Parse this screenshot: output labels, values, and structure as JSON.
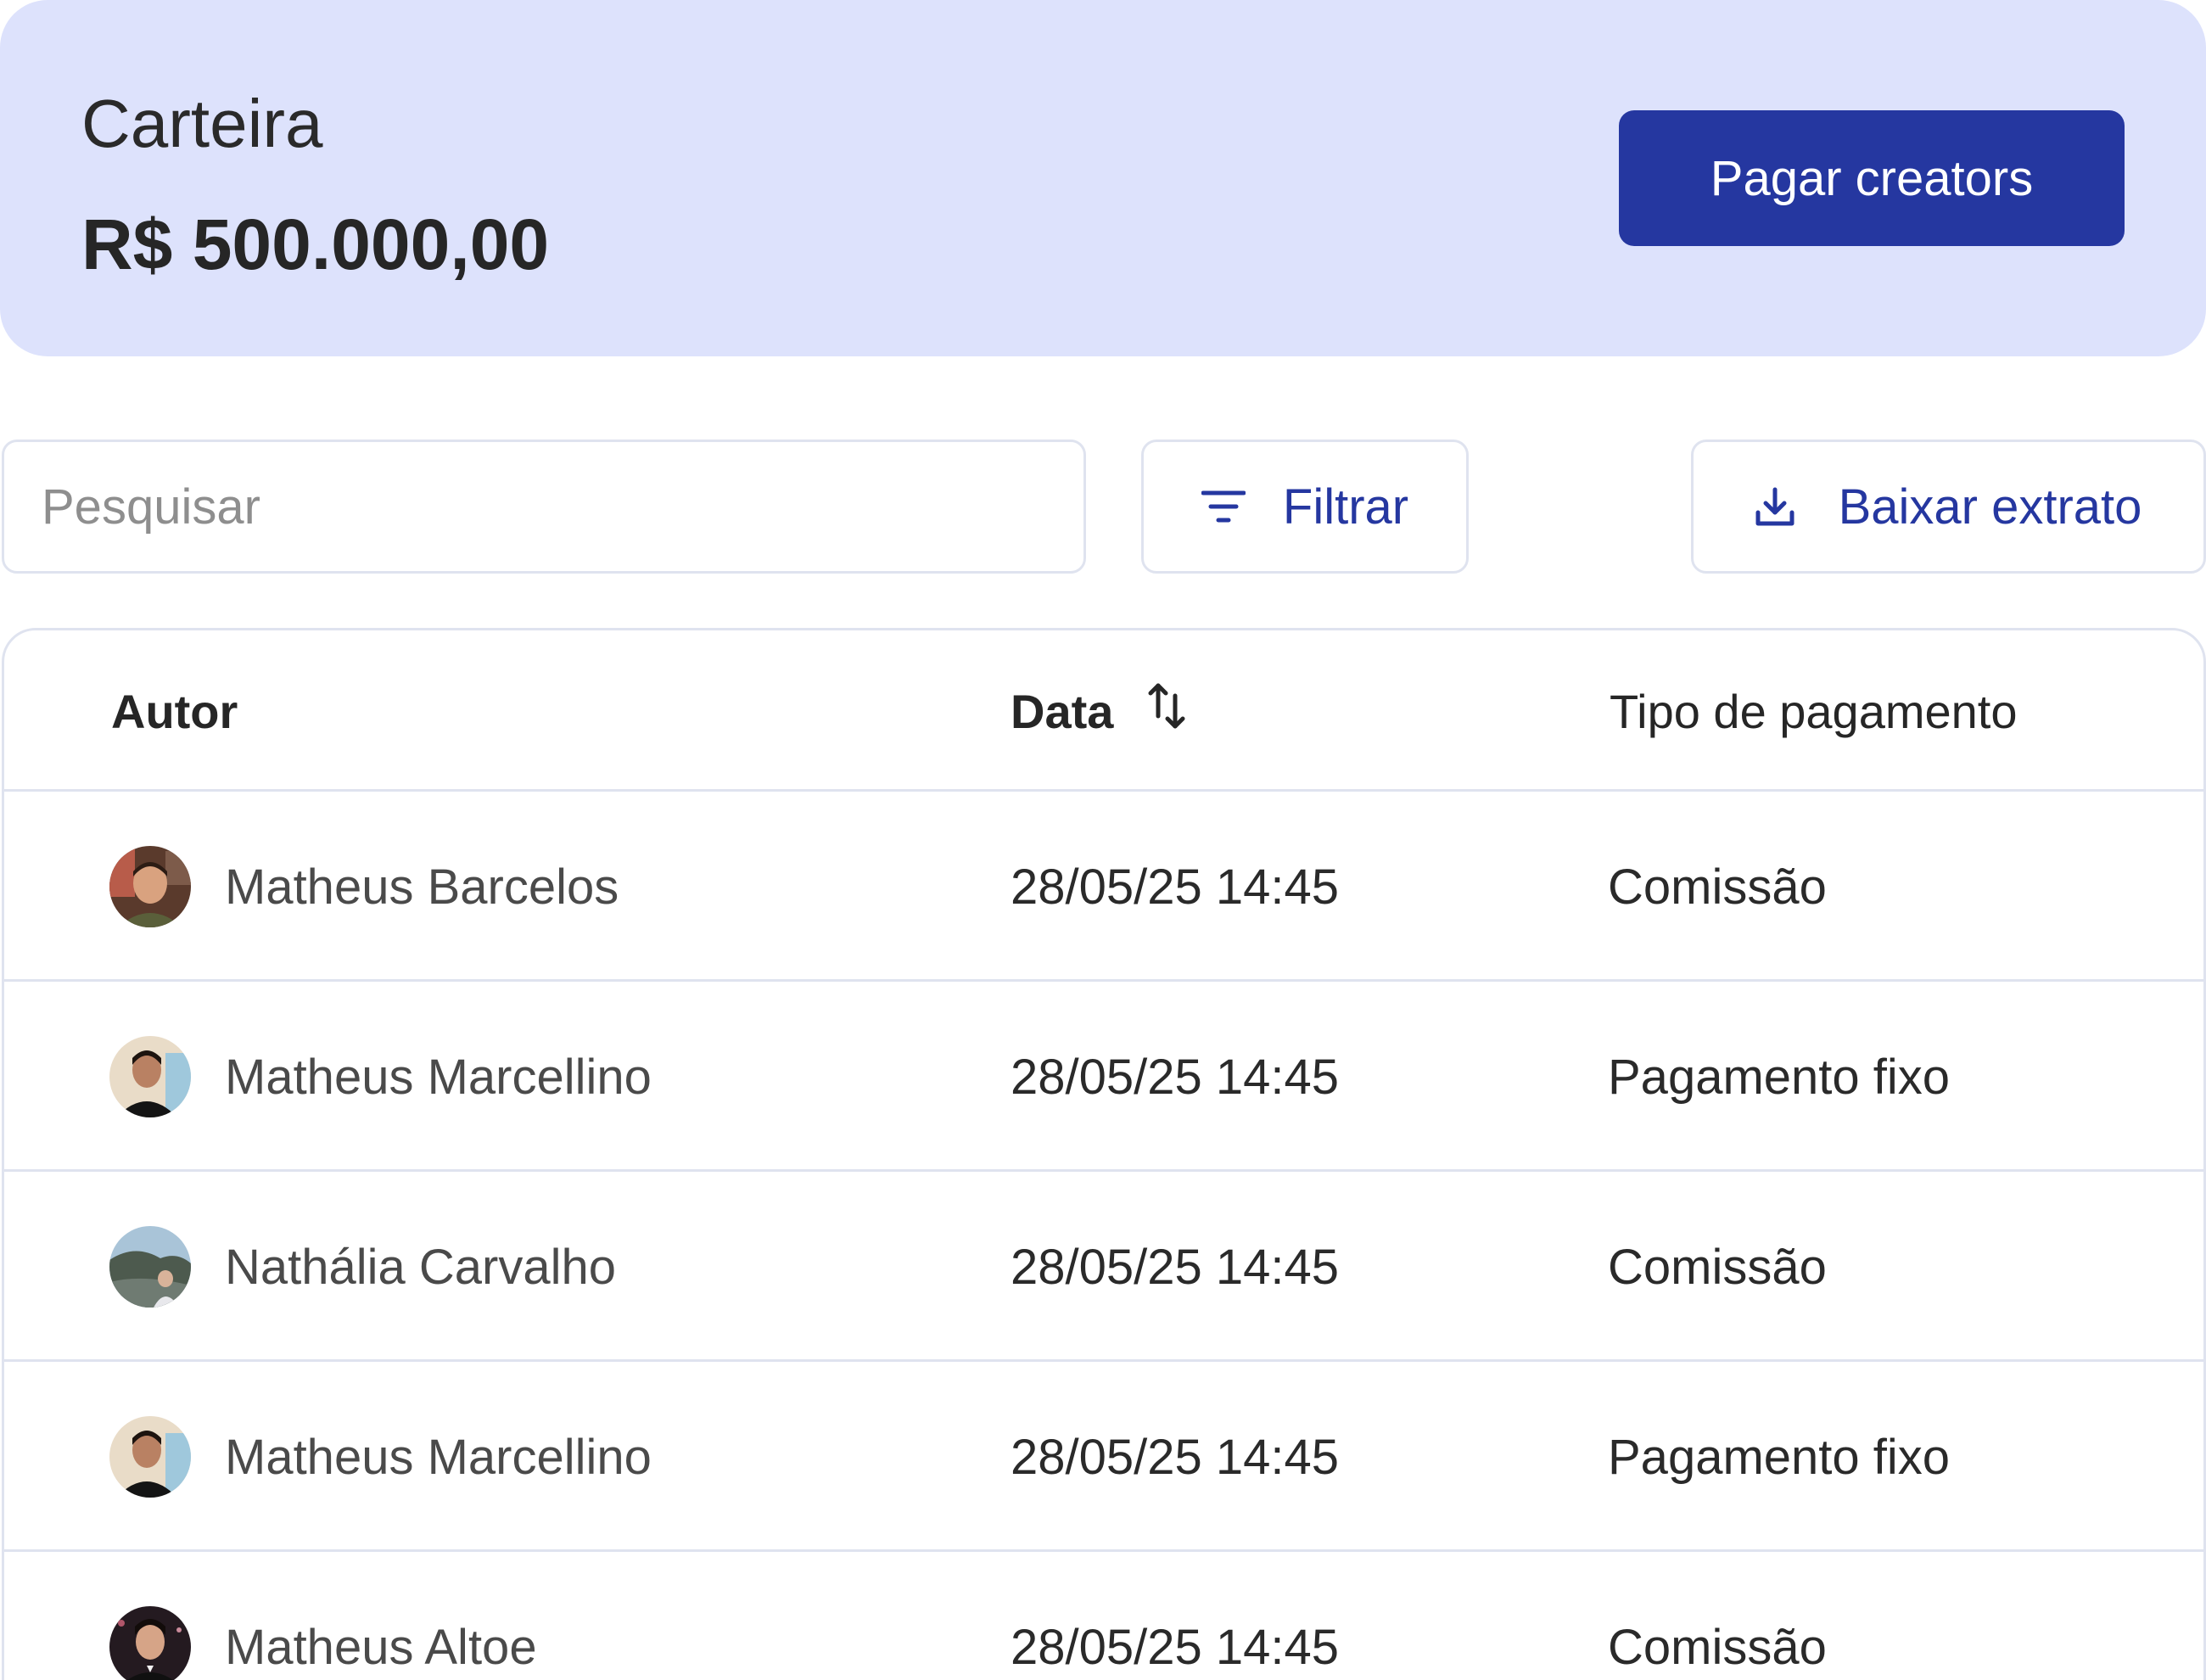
{
  "wallet": {
    "title": "Carteira",
    "balance": "R$ 500.000,00",
    "pay_button_label": "Pagar creators"
  },
  "toolbar": {
    "search_placeholder": "Pesquisar",
    "filter_label": "Filtrar",
    "download_label": "Baixar extrato"
  },
  "table": {
    "headers": {
      "author": "Autor",
      "date": "Data",
      "type": "Tipo de pagamento"
    },
    "rows": [
      {
        "author": "Matheus Barcelos",
        "date": "28/05/25 14:45",
        "type": "Comissão"
      },
      {
        "author": "Matheus Marcellino",
        "date": "28/05/25 14:45",
        "type": "Pagamento fixo"
      },
      {
        "author": "Nathália Carvalho",
        "date": "28/05/25 14:45",
        "type": "Comissão"
      },
      {
        "author": "Matheus Marcellino",
        "date": "28/05/25 14:45",
        "type": "Pagamento fixo"
      },
      {
        "author": "Matheus Altoe",
        "date": "28/05/25 14:45",
        "type": "Comissão"
      }
    ]
  },
  "colors": {
    "wallet_background": "#dde2fc",
    "accent": "#2537a0",
    "border": "#dfe3ef"
  },
  "icons": {
    "filter": "filter-lines-icon",
    "download": "download-icon",
    "sort": "sort-arrows-icon"
  }
}
